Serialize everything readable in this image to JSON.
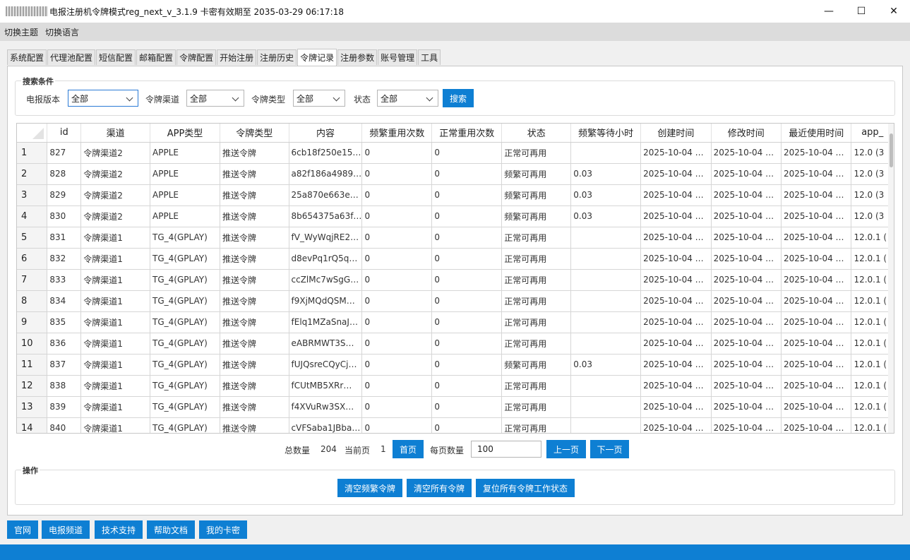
{
  "window": {
    "title": "电报注册机令牌模式reg_next_v_3.1.9 卡密有效期至 2035-03-29 06:17:18",
    "minimize": "—",
    "maximize": "☐",
    "close": "✕"
  },
  "menu": [
    "切换主题",
    "切换语言"
  ],
  "tabs": [
    "系统配置",
    "代理池配置",
    "短信配置",
    "邮箱配置",
    "令牌配置",
    "开始注册",
    "注册历史",
    "令牌记录",
    "注册参数",
    "账号管理",
    "工具"
  ],
  "active_tab_index": 7,
  "search": {
    "title": "搜索条件",
    "version_label": "电报版本",
    "version_value": "全部",
    "channel_label": "令牌渠道",
    "channel_value": "全部",
    "type_label": "令牌类型",
    "type_value": "全部",
    "status_label": "状态",
    "status_value": "全部",
    "search_button": "搜索"
  },
  "table": {
    "columns": [
      "id",
      "渠道",
      "APP类型",
      "令牌类型",
      "内容",
      "频繁重用次数",
      "正常重用次数",
      "状态",
      "频繁等待小时",
      "创建时间",
      "修改时间",
      "最近使用时间",
      "app_"
    ],
    "rows": [
      [
        "1",
        "827",
        "令牌渠道2",
        "APPLE",
        "推送令牌",
        "6cb18f250e15…",
        "0",
        "0",
        "正常可再用",
        "",
        "2025-10-04 …",
        "2025-10-04 …",
        "2025-10-04 …",
        "12.0 (3"
      ],
      [
        "2",
        "828",
        "令牌渠道2",
        "APPLE",
        "推送令牌",
        "a82f186a4989…",
        "0",
        "0",
        "频繁可再用",
        "0.03",
        "2025-10-04 …",
        "2025-10-04 …",
        "2025-10-04 …",
        "12.0 (3"
      ],
      [
        "3",
        "829",
        "令牌渠道2",
        "APPLE",
        "推送令牌",
        "25a870e663e…",
        "0",
        "0",
        "频繁可再用",
        "0.03",
        "2025-10-04 …",
        "2025-10-04 …",
        "2025-10-04 …",
        "12.0 (3"
      ],
      [
        "4",
        "830",
        "令牌渠道2",
        "APPLE",
        "推送令牌",
        "8b654375a63f…",
        "0",
        "0",
        "频繁可再用",
        "0.03",
        "2025-10-04 …",
        "2025-10-04 …",
        "2025-10-04 …",
        "12.0 (3"
      ],
      [
        "5",
        "831",
        "令牌渠道1",
        "TG_4(GPLAY)",
        "推送令牌",
        "fV_WyWqjRE2…",
        "0",
        "0",
        "正常可再用",
        "",
        "2025-10-04 …",
        "2025-10-04 …",
        "2025-10-04 …",
        "12.0.1 ("
      ],
      [
        "6",
        "832",
        "令牌渠道1",
        "TG_4(GPLAY)",
        "推送令牌",
        "d8evPq1rQ5q…",
        "0",
        "0",
        "正常可再用",
        "",
        "2025-10-04 …",
        "2025-10-04 …",
        "2025-10-04 …",
        "12.0.1 ("
      ],
      [
        "7",
        "833",
        "令牌渠道1",
        "TG_4(GPLAY)",
        "推送令牌",
        "ccZlMc7wSgG…",
        "0",
        "0",
        "正常可再用",
        "",
        "2025-10-04 …",
        "2025-10-04 …",
        "2025-10-04 …",
        "12.0.1 ("
      ],
      [
        "8",
        "834",
        "令牌渠道1",
        "TG_4(GPLAY)",
        "推送令牌",
        "f9XjMQdQSM…",
        "0",
        "0",
        "正常可再用",
        "",
        "2025-10-04 …",
        "2025-10-04 …",
        "2025-10-04 …",
        "12.0.1 ("
      ],
      [
        "9",
        "835",
        "令牌渠道1",
        "TG_4(GPLAY)",
        "推送令牌",
        "fElq1MZaSnaJ…",
        "0",
        "0",
        "正常可再用",
        "",
        "2025-10-04 …",
        "2025-10-04 …",
        "2025-10-04 …",
        "12.0.1 ("
      ],
      [
        "10",
        "836",
        "令牌渠道1",
        "TG_4(GPLAY)",
        "推送令牌",
        "eABRMWT3S…",
        "0",
        "0",
        "正常可再用",
        "",
        "2025-10-04 …",
        "2025-10-04 …",
        "2025-10-04 …",
        "12.0.1 ("
      ],
      [
        "11",
        "837",
        "令牌渠道1",
        "TG_4(GPLAY)",
        "推送令牌",
        "fUJQsreCQyCj…",
        "0",
        "0",
        "频繁可再用",
        "0.03",
        "2025-10-04 …",
        "2025-10-04 …",
        "2025-10-04 …",
        "12.0.1 ("
      ],
      [
        "12",
        "838",
        "令牌渠道1",
        "TG_4(GPLAY)",
        "推送令牌",
        "fCUtMB5XRr…",
        "0",
        "0",
        "正常可再用",
        "",
        "2025-10-04 …",
        "2025-10-04 …",
        "2025-10-04 …",
        "12.0.1 ("
      ],
      [
        "13",
        "839",
        "令牌渠道1",
        "TG_4(GPLAY)",
        "推送令牌",
        "f4XVuRw3SX…",
        "0",
        "0",
        "正常可再用",
        "",
        "2025-10-04 …",
        "2025-10-04 …",
        "2025-10-04 …",
        "12.0.1 ("
      ],
      [
        "14",
        "840",
        "令牌渠道1",
        "TG_4(GPLAY)",
        "推送令牌",
        "cVFSaba1JBba…",
        "0",
        "0",
        "正常可再用",
        "",
        "2025-10-04 …",
        "2025-10-04 …",
        "2025-10-04 …",
        "12.0.1 ("
      ]
    ]
  },
  "pager": {
    "total_label": "总数量",
    "total_value": "204",
    "current_label": "当前页",
    "current_value": "1",
    "first_button": "首页",
    "per_page_label": "每页数量",
    "per_page_value": "100",
    "prev_button": "上一页",
    "next_button": "下一页"
  },
  "operations": {
    "title": "操作",
    "clear_frequent": "清空频繁令牌",
    "clear_all": "清空所有令牌",
    "reset_all": "复位所有令牌工作状态"
  },
  "footer_buttons": [
    "官网",
    "电报频道",
    "技术支持",
    "帮助文档",
    "我的卡密"
  ]
}
